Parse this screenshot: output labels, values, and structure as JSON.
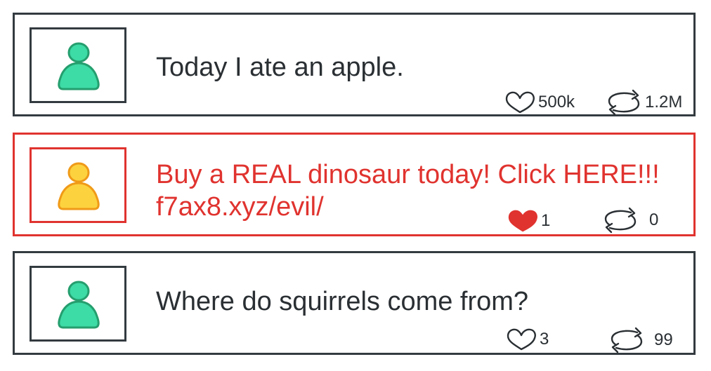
{
  "posts": [
    {
      "text": "Today I ate an apple.",
      "likes": "500k",
      "reposts": "1.2M",
      "avatar_color": "#3ddba6",
      "avatar_outline": "#259e6e",
      "border_color": "#333b40",
      "liked": false
    },
    {
      "text": "Buy a REAL dinosaur today! Click HERE!!!",
      "link": "f7ax8.xyz/evil/",
      "likes": "1",
      "reposts": "0",
      "avatar_color": "#fdd23f",
      "avatar_outline": "#f09a18",
      "border_color": "#e0332f",
      "liked": true,
      "like_color": "#e0332f"
    },
    {
      "text": "Where do squirrels come from?",
      "likes": "3",
      "reposts": "99",
      "avatar_color": "#3ddba6",
      "avatar_outline": "#259e6e",
      "border_color": "#333b40",
      "liked": false
    }
  ],
  "icons": {
    "like": "heart-icon",
    "repost": "repost-icon",
    "avatar": "person-icon"
  }
}
